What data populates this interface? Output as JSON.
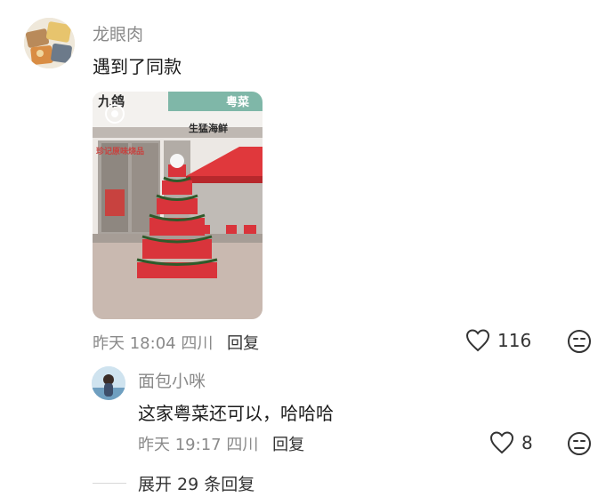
{
  "main_comment": {
    "username": "龙眼肉",
    "text": "遇到了同款",
    "time": "昨天 18:04",
    "location": "四川",
    "reply_label": "回复",
    "like_count": "116",
    "photo_texts": {
      "sign_left": "九鸽",
      "sign_mid": "生猛海鲜",
      "sign_right": "粤菜",
      "banner": "珍记原味烧品"
    }
  },
  "sub_comment": {
    "username": "面包小咪",
    "text": "这家粤菜还可以，哈哈哈",
    "time": "昨天 19:17",
    "location": "四川",
    "reply_label": "回复",
    "like_count": "8"
  },
  "expand_label": "展开 29 条回复",
  "colors": {
    "muted": "#8a8a8a",
    "text": "#1b1b1b",
    "stool_red": "#d9343b"
  }
}
